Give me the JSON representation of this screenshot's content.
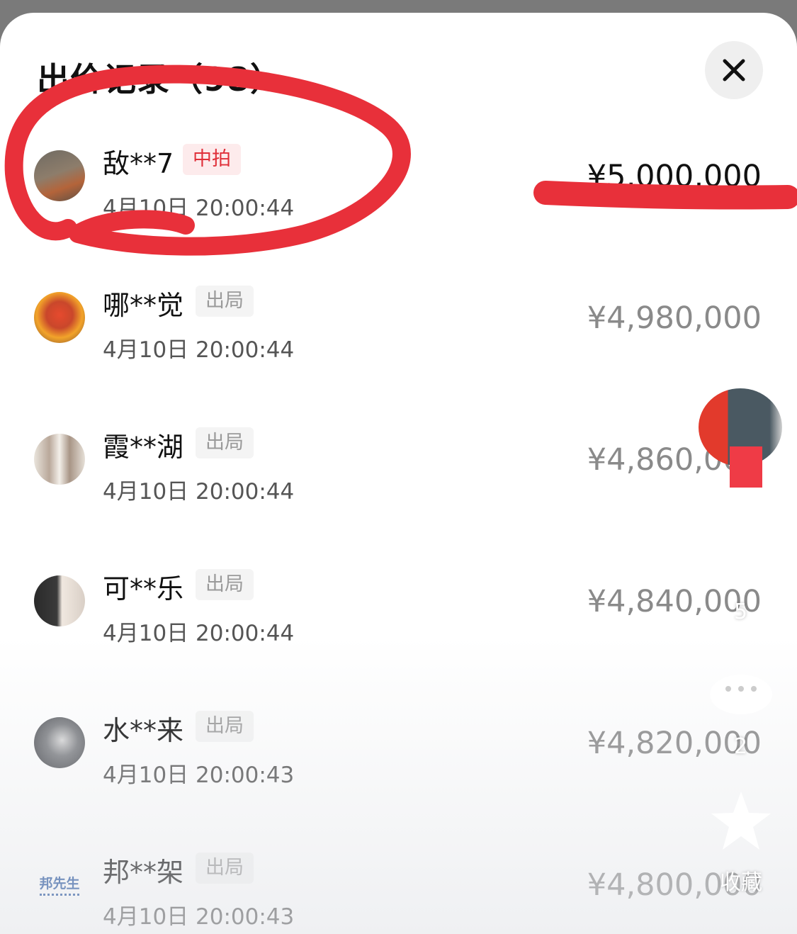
{
  "sheet": {
    "title": "出价记录（98）"
  },
  "bids": [
    {
      "user": "敌**7",
      "badge": "中拍",
      "time": "4月10日 20:00:44",
      "price": "¥5,000,000"
    },
    {
      "user": "哪**觉",
      "badge": "出局",
      "time": "4月10日 20:00:44",
      "price": "¥4,980,000"
    },
    {
      "user": "霞**湖",
      "badge": "出局",
      "time": "4月10日 20:00:44",
      "price": "¥4,860,000"
    },
    {
      "user": "可**乐",
      "badge": "出局",
      "time": "4月10日 20:00:44",
      "price": "¥4,840,000"
    },
    {
      "user": "水**来",
      "badge": "出局",
      "time": "4月10日 20:00:43",
      "price": "¥4,820,000"
    },
    {
      "user": "邦**架",
      "badge": "出局",
      "time": "4月10日 20:00:43",
      "price": "¥4,800,000"
    }
  ],
  "avatars": {
    "bangxiansheng_text": "邦先生"
  },
  "side_panel": {
    "like_count": "5",
    "comment_count": "2",
    "favorite_label": "收藏"
  },
  "colors": {
    "annotation_red": "#e8303a",
    "win_badge_text": "#e0303a",
    "win_badge_bg": "#fdebec",
    "out_badge_text": "#9a9a9a"
  }
}
